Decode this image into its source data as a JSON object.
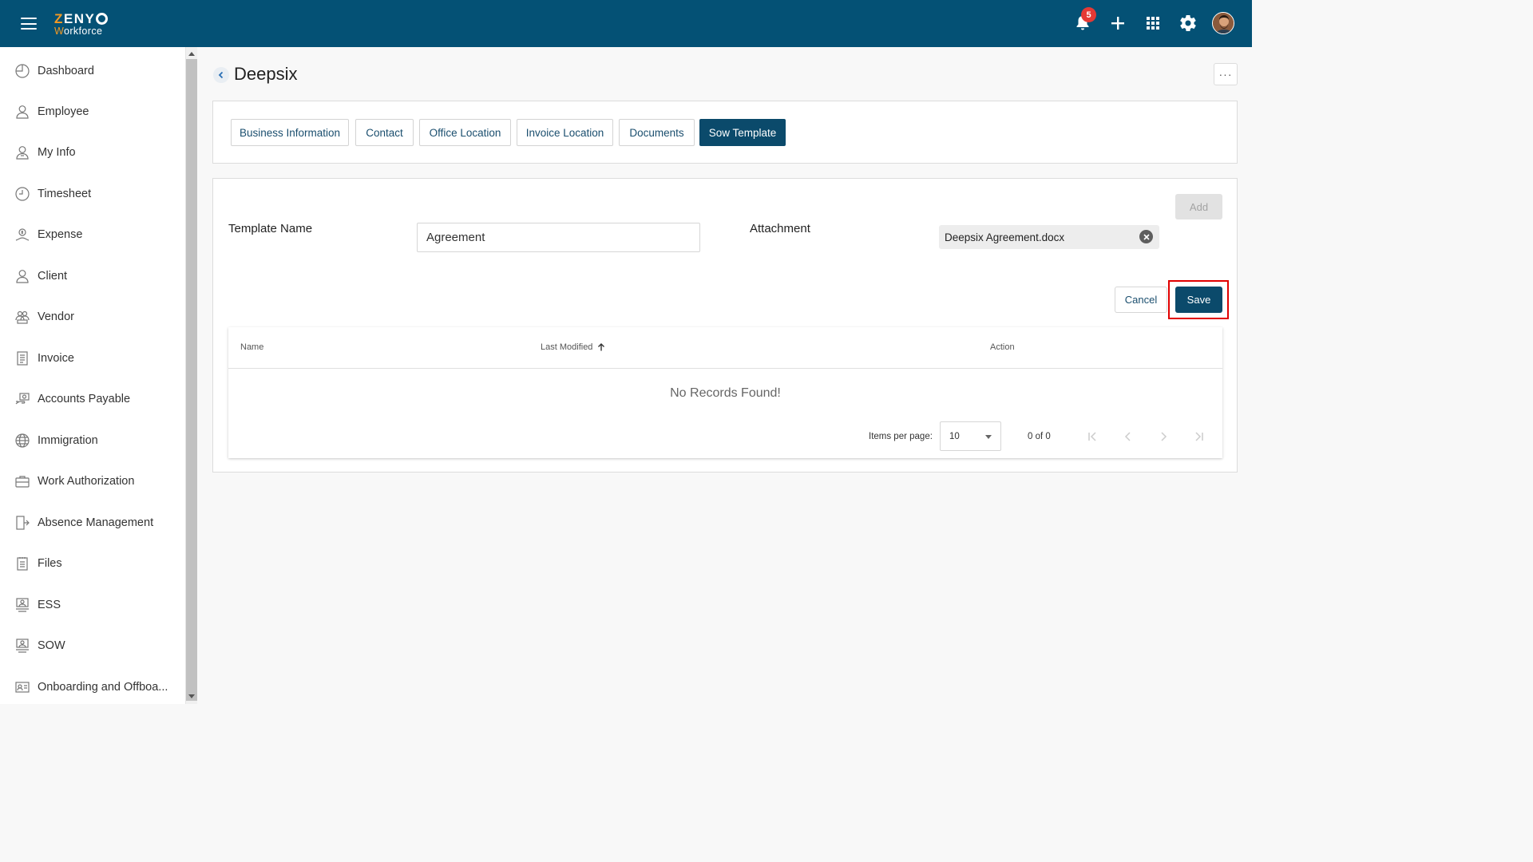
{
  "app": {
    "logo_text": "ZENY",
    "logo_sub": "Workforce",
    "notification_count": "5"
  },
  "header_icons": [
    "bell-icon",
    "plus-icon",
    "apps-grid-icon",
    "gear-icon",
    "user-avatar"
  ],
  "sidebar": {
    "items": [
      {
        "label": "Dashboard",
        "icon": "dashboard-icon"
      },
      {
        "label": "Employee",
        "icon": "employee-icon"
      },
      {
        "label": "My Info",
        "icon": "my-info-icon"
      },
      {
        "label": "Timesheet",
        "icon": "clock-icon"
      },
      {
        "label": "Expense",
        "icon": "expense-icon"
      },
      {
        "label": "Client",
        "icon": "client-icon"
      },
      {
        "label": "Vendor",
        "icon": "vendor-icon"
      },
      {
        "label": "Invoice",
        "icon": "invoice-icon"
      },
      {
        "label": "Accounts Payable",
        "icon": "accounts-payable-icon"
      },
      {
        "label": "Immigration",
        "icon": "globe-icon"
      },
      {
        "label": "Work Authorization",
        "icon": "briefcase-icon"
      },
      {
        "label": "Absence Management",
        "icon": "exit-door-icon"
      },
      {
        "label": "Files",
        "icon": "files-icon"
      },
      {
        "label": "ESS",
        "icon": "ess-icon"
      },
      {
        "label": "SOW",
        "icon": "sow-icon"
      },
      {
        "label": "Onboarding and Offboa...",
        "icon": "id-card-icon"
      }
    ]
  },
  "page": {
    "title": "Deepsix",
    "more_label": "···"
  },
  "tabs": [
    {
      "label": "Business Information",
      "active": false
    },
    {
      "label": "Contact",
      "active": false
    },
    {
      "label": "Office Location",
      "active": false
    },
    {
      "label": "Invoice Location",
      "active": false
    },
    {
      "label": "Documents",
      "active": false
    },
    {
      "label": "Sow Template",
      "active": true
    }
  ],
  "form": {
    "add_label": "Add",
    "template_name_label": "Template Name",
    "template_name_value": "Agreement",
    "attachment_label": "Attachment",
    "attachment_file": "Deepsix Agreement.docx",
    "cancel_label": "Cancel",
    "save_label": "Save"
  },
  "table": {
    "columns": [
      "Name",
      "Last Modified",
      "Action"
    ],
    "sort_column": "Last Modified",
    "empty_text": "No Records Found!",
    "items_per_page_label": "Items per page:",
    "items_per_page_value": "10",
    "range_label": "0 of 0"
  },
  "colors": {
    "header_bg": "#045175",
    "primary_button": "#0b4a6b",
    "highlight_border": "#e10000",
    "logo_accent": "#f59a23"
  }
}
